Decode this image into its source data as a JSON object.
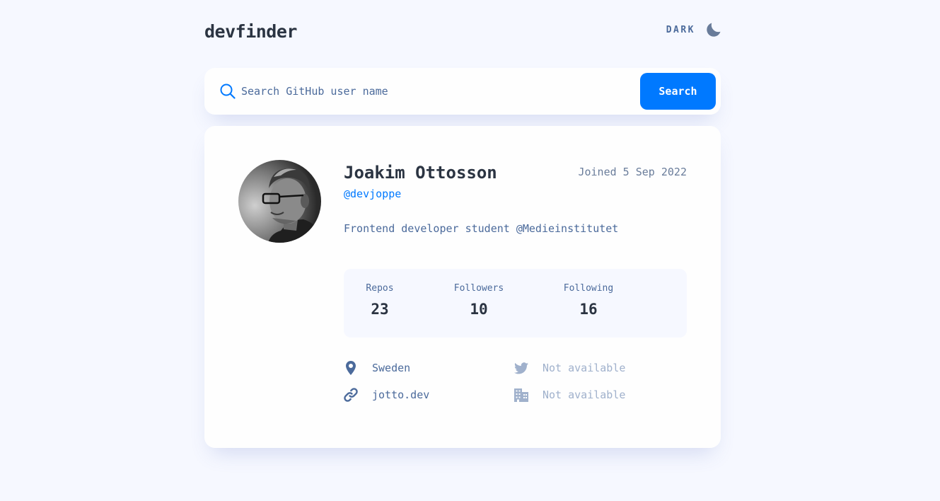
{
  "app": {
    "logo": "devfinder",
    "theme_toggle_label": "DARK"
  },
  "search": {
    "placeholder": "Search GitHub user name",
    "value": "",
    "button_label": "Search"
  },
  "profile": {
    "name": "Joakim Ottosson",
    "username": "@devjoppe",
    "joined": "Joined 5 Sep 2022",
    "bio": "Frontend developer student @Medieinstitutet",
    "stats": {
      "repos_label": "Repos",
      "repos": "23",
      "followers_label": "Followers",
      "followers": "10",
      "following_label": "Following",
      "following": "16"
    },
    "links": {
      "location": "Sweden",
      "website": "jotto.dev",
      "twitter": "Not available",
      "company": "Not available"
    }
  },
  "colors": {
    "background": "#f6f8ff",
    "card": "#fefefe",
    "accent": "#0079ff",
    "heading": "#2b3442",
    "text": "#4b6a9b",
    "unavailable": "#a0b1cc"
  },
  "icons": {
    "theme": "moon-icon",
    "search": "search-icon",
    "location": "location-pin-icon",
    "website": "link-icon",
    "twitter": "twitter-icon",
    "company": "building-icon"
  }
}
